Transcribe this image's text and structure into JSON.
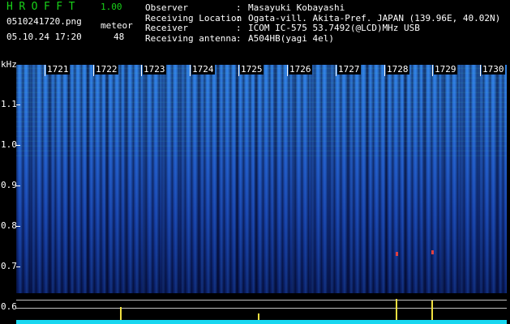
{
  "app": {
    "title": "HROFFT",
    "version": "1.00"
  },
  "file": {
    "name": "0510241720.png",
    "timestamp": "05.10.24 17:20"
  },
  "meteor": {
    "label": "meteor",
    "count": "48"
  },
  "station": [
    {
      "key": "Observer",
      "value": "Masayuki Kobayashi"
    },
    {
      "key": "Receiving Location",
      "value": "Ogata-vill. Akita-Pref. JAPAN (139.96E, 40.02N)"
    },
    {
      "key": "Receiver",
      "value": "ICOM IC-575 53.7492(@LCD)MHz USB"
    },
    {
      "key": "Receiving antenna",
      "value": "A504HB(yagi 4el)"
    }
  ],
  "axis": {
    "unit": "kHz",
    "y_ticks": [
      "1.1",
      "1.0",
      "0.9",
      "0.8",
      "0.7",
      "0.6"
    ],
    "minutes": [
      "1721",
      "1722",
      "1723",
      "1724",
      "1725",
      "1726",
      "1727",
      "1728",
      "1729",
      "1730"
    ]
  },
  "colors": {
    "header_green": "#19d219",
    "baseline": "#19d7f0",
    "spike": "#f0e040"
  }
}
